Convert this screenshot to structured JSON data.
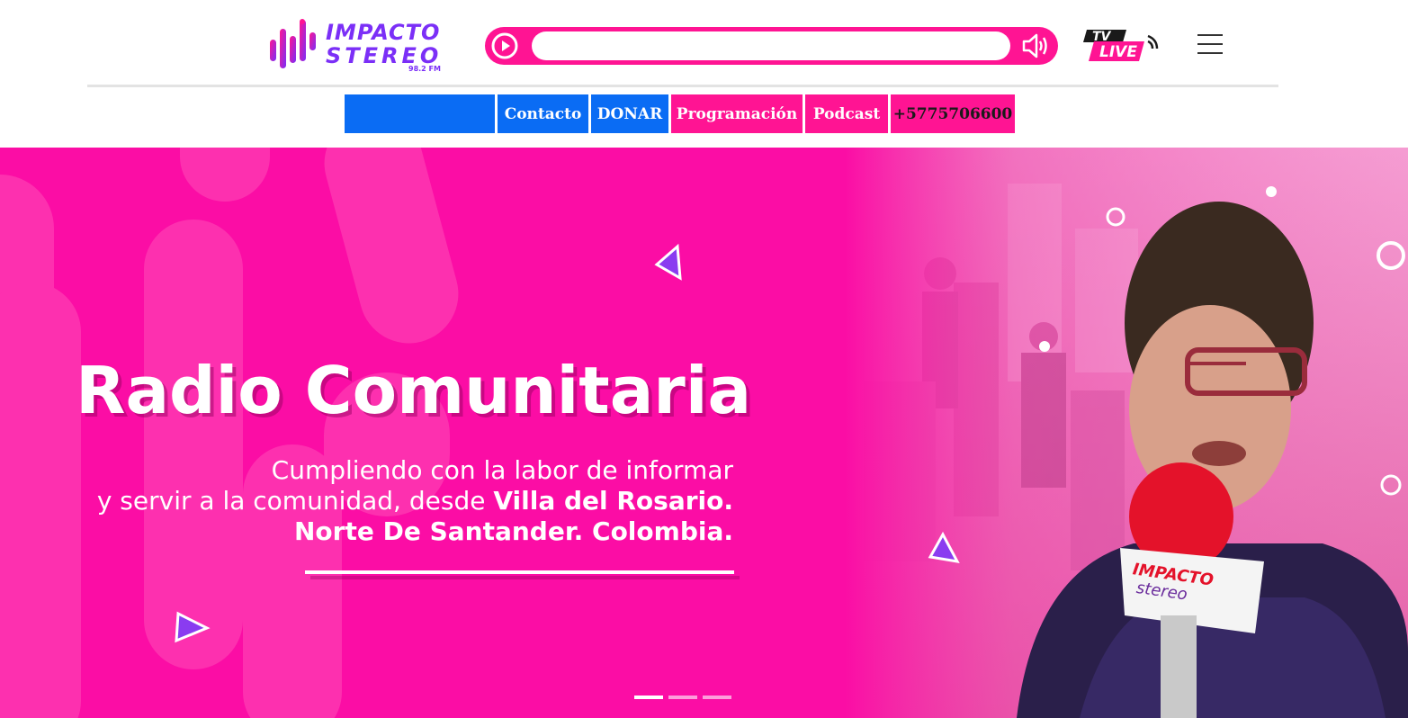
{
  "brand": {
    "logo_line1": "IMPACTO",
    "logo_line2": "STEREO",
    "logo_freq": "98.2 FM",
    "tv_live_top": "TV",
    "tv_live_bottom": "LIVE"
  },
  "nav": {
    "items": [
      {
        "label": "",
        "style": "blue"
      },
      {
        "label": "Contacto",
        "style": "blue"
      },
      {
        "label": "DONAR",
        "style": "blue"
      },
      {
        "label": "Programación",
        "style": "pink"
      },
      {
        "label": "Podcast",
        "style": "pink"
      },
      {
        "label": "+5775706600",
        "style": "pink-dark"
      }
    ]
  },
  "hero": {
    "title": "Radio Comunitaria",
    "sub_line1": "Cumpliendo con la labor de informar",
    "sub_line2_plain": "y servir a la comunidad, desde ",
    "sub_line2_bold": "Villa del Rosario.",
    "sub_line3": "Norte De Santander. Colombia.",
    "mic_label_1": "IMPACTO",
    "mic_label_2": "stereo",
    "slides": 3,
    "active_slide": 1
  },
  "colors": {
    "pink": "#ff1493",
    "blue": "#0a6cf4",
    "purple": "#7b2ff7"
  }
}
